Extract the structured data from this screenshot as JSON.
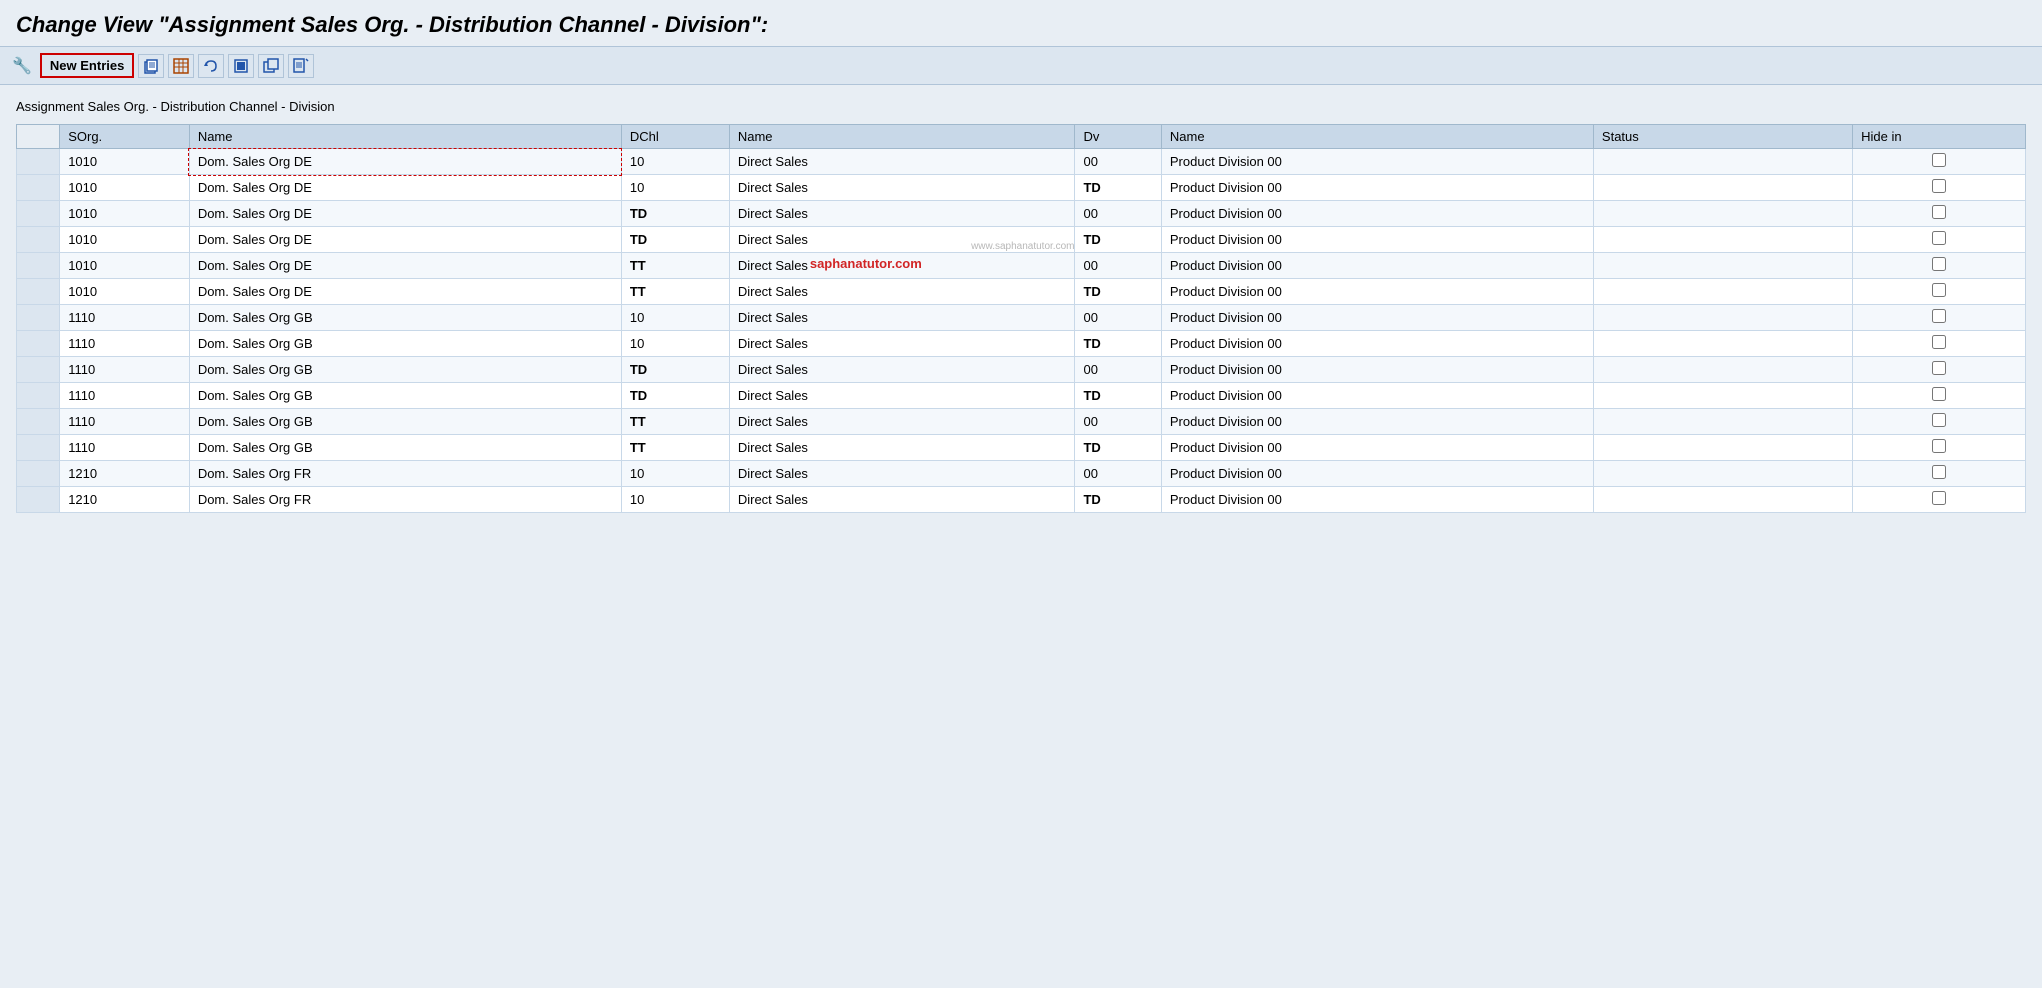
{
  "page": {
    "title": "Change View \"Assignment Sales Org. - Distribution Channel - Division\":",
    "section_label": "Assignment Sales Org. - Distribution Channel - Division"
  },
  "toolbar": {
    "new_entries_label": "New Entries",
    "icons": [
      {
        "name": "copy-icon",
        "symbol": "📋"
      },
      {
        "name": "table-icon",
        "symbol": "▦"
      },
      {
        "name": "undo-icon",
        "symbol": "↩"
      },
      {
        "name": "select-all-icon",
        "symbol": "▣"
      },
      {
        "name": "deselect-icon",
        "symbol": "▤"
      },
      {
        "name": "download-icon",
        "symbol": "⬇"
      }
    ],
    "lead_icon": "🔧"
  },
  "table": {
    "columns": [
      {
        "key": "sorg",
        "label": "SOrg."
      },
      {
        "key": "name1",
        "label": "Name"
      },
      {
        "key": "dchl",
        "label": "DChl"
      },
      {
        "key": "name2",
        "label": "Name"
      },
      {
        "key": "dv",
        "label": "Dv"
      },
      {
        "key": "name3",
        "label": "Name"
      },
      {
        "key": "status",
        "label": "Status"
      },
      {
        "key": "hidein",
        "label": "Hide in"
      }
    ],
    "rows": [
      {
        "sorg": "1010",
        "name1": "Dom. Sales Org DE",
        "dchl": "10",
        "name2": "Direct Sales",
        "dv": "00",
        "name3": "Product Division 00",
        "status": "",
        "hidein": false,
        "dchl_bold": false
      },
      {
        "sorg": "1010",
        "name1": "Dom. Sales Org DE",
        "dchl": "10",
        "name2": "Direct Sales",
        "dv": "TD",
        "name3": "Product Division 00",
        "status": "",
        "hidein": false,
        "dchl_bold": false
      },
      {
        "sorg": "1010",
        "name1": "Dom. Sales Org DE",
        "dchl": "TD",
        "name2": "Direct Sales",
        "dv": "00",
        "name3": "Product Division 00",
        "status": "",
        "hidein": false,
        "dchl_bold": true
      },
      {
        "sorg": "1010",
        "name1": "Dom. Sales Org DE",
        "dchl": "TD",
        "name2": "Direct Sales",
        "dv": "TD",
        "name3": "Product Division 00",
        "status": "",
        "hidein": false,
        "dchl_bold": true
      },
      {
        "sorg": "1010",
        "name1": "Dom. Sales Org DE",
        "dchl": "TT",
        "name2": "Direct Sales",
        "dv": "00",
        "name3": "Product Division 00",
        "status": "",
        "hidein": false,
        "dchl_bold": true
      },
      {
        "sorg": "1010",
        "name1": "Dom. Sales Org DE",
        "dchl": "TT",
        "name2": "Direct Sales",
        "dv": "TD",
        "name3": "Product Division 00",
        "status": "",
        "hidein": false,
        "dchl_bold": true
      },
      {
        "sorg": "1110",
        "name1": "Dom. Sales Org GB",
        "dchl": "10",
        "name2": "Direct Sales",
        "dv": "00",
        "name3": "Product Division 00",
        "status": "",
        "hidein": false,
        "dchl_bold": false
      },
      {
        "sorg": "1110",
        "name1": "Dom. Sales Org GB",
        "dchl": "10",
        "name2": "Direct Sales",
        "dv": "TD",
        "name3": "Product Division 00",
        "status": "",
        "hidein": false,
        "dchl_bold": false
      },
      {
        "sorg": "1110",
        "name1": "Dom. Sales Org GB",
        "dchl": "TD",
        "name2": "Direct Sales",
        "dv": "00",
        "name3": "Product Division 00",
        "status": "",
        "hidein": false,
        "dchl_bold": true
      },
      {
        "sorg": "1110",
        "name1": "Dom. Sales Org GB",
        "dchl": "TD",
        "name2": "Direct Sales",
        "dv": "TD",
        "name3": "Product Division 00",
        "status": "",
        "hidein": false,
        "dchl_bold": true
      },
      {
        "sorg": "1110",
        "name1": "Dom. Sales Org GB",
        "dchl": "TT",
        "name2": "Direct Sales",
        "dv": "00",
        "name3": "Product Division 00",
        "status": "",
        "hidein": false,
        "dchl_bold": true
      },
      {
        "sorg": "1110",
        "name1": "Dom. Sales Org GB",
        "dchl": "TT",
        "name2": "Direct Sales",
        "dv": "TD",
        "name3": "Product Division 00",
        "status": "",
        "hidein": false,
        "dchl_bold": true
      },
      {
        "sorg": "1210",
        "name1": "Dom. Sales Org FR",
        "dchl": "10",
        "name2": "Direct Sales",
        "dv": "00",
        "name3": "Product Division 00",
        "status": "",
        "hidein": false,
        "dchl_bold": false
      },
      {
        "sorg": "1210",
        "name1": "Dom. Sales Org FR",
        "dchl": "10",
        "name2": "Direct Sales",
        "dv": "TD",
        "name3": "Product Division 00",
        "status": "",
        "hidein": false,
        "dchl_bold": false
      }
    ]
  },
  "colors": {
    "accent_red": "#cc0000",
    "header_bg": "#c8d8e8",
    "toolbar_bg": "#dce6f0",
    "body_bg": "#e8eef4"
  }
}
